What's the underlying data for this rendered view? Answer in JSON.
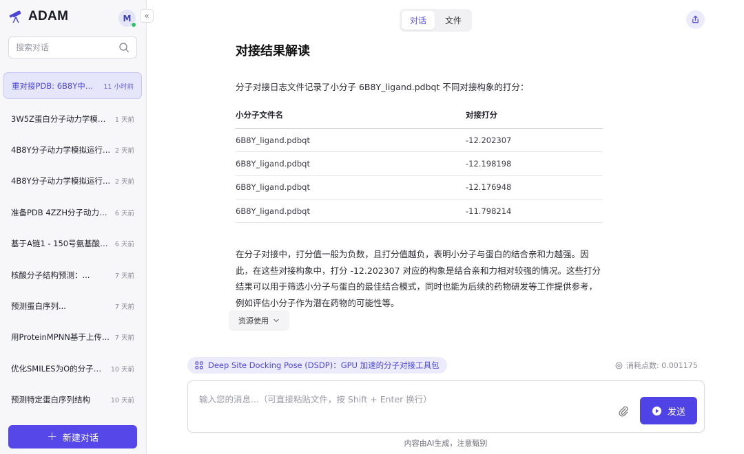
{
  "sidebar": {
    "brand": "ADAM",
    "avatar_initial": "M",
    "search_placeholder": "搜索对话",
    "conversations": [
      {
        "title": "重对接PDB: 6B8Y中蛋...",
        "time": "11 小时前",
        "active": true
      },
      {
        "title": "3W5Z蛋白分子动力学模拟...",
        "time": "1 天前"
      },
      {
        "title": "4B8Y分子动力学模拟运行...",
        "time": "2 天前"
      },
      {
        "title": "4B8Y分子动力学模拟运行...",
        "time": "2 天前"
      },
      {
        "title": "准备PDB 4ZZH分子动力学...",
        "time": "6 天前"
      },
      {
        "title": "基于A链1 - 150号氨基酸及...",
        "time": "6 天前"
      },
      {
        "title": "核酸分子结构预测：...",
        "time": "7 天前"
      },
      {
        "title": "预测蛋白序列...",
        "time": "7 天前"
      },
      {
        "title": "用ProteinMPNN基于上传...",
        "time": "7 天前"
      },
      {
        "title": "优化SMILES为O的分子结...",
        "time": "10 天前"
      },
      {
        "title": "预测特定蛋白序列结构",
        "time": "10 天前"
      }
    ],
    "new_chat_label": "新建对话"
  },
  "header": {
    "tabs": [
      {
        "label": "对话",
        "active": true
      },
      {
        "label": "文件",
        "active": false
      }
    ]
  },
  "message": {
    "title": "对接结果解读",
    "intro": "分子对接日志文件记录了小分子 6B8Y_ligand.pdbqt 不同对接构象的打分：",
    "table": {
      "headers": [
        "小分子文件名",
        "对接打分"
      ],
      "rows": [
        [
          "6B8Y_ligand.pdbqt",
          "-12.202307"
        ],
        [
          "6B8Y_ligand.pdbqt",
          "-12.198198"
        ],
        [
          "6B8Y_ligand.pdbqt",
          "-12.176948"
        ],
        [
          "6B8Y_ligand.pdbqt",
          "-11.798214"
        ]
      ]
    },
    "paragraph": "在分子对接中，打分值一般为负数，且打分值越负，表明小分子与蛋白的结合亲和力越强。因此，在这些对接构象中，打分 -12.202307 对应的构象是结合亲和力相对较强的情况。这些打分结果可以用于筛选小分子与蛋白的最佳结合模式，同时也能为后续的药物研发等工作提供参考，例如评估小分子作为潜在药物的可能性等。",
    "resources_label": "资源使用"
  },
  "composer": {
    "tool_chip": "Deep Site Docking Pose (DSDP)：GPU 加速的分子对接工具包",
    "cost_label": "消耗点数: 0.001175",
    "placeholder": "输入您的消息...（可直接粘贴文件，按 Shift + Enter 换行）",
    "send_label": "发送",
    "disclaimer": "内容由AI生成，注意甄别"
  },
  "colors": {
    "accent": "#5648e8",
    "active_bg": "#e6e6fb"
  }
}
